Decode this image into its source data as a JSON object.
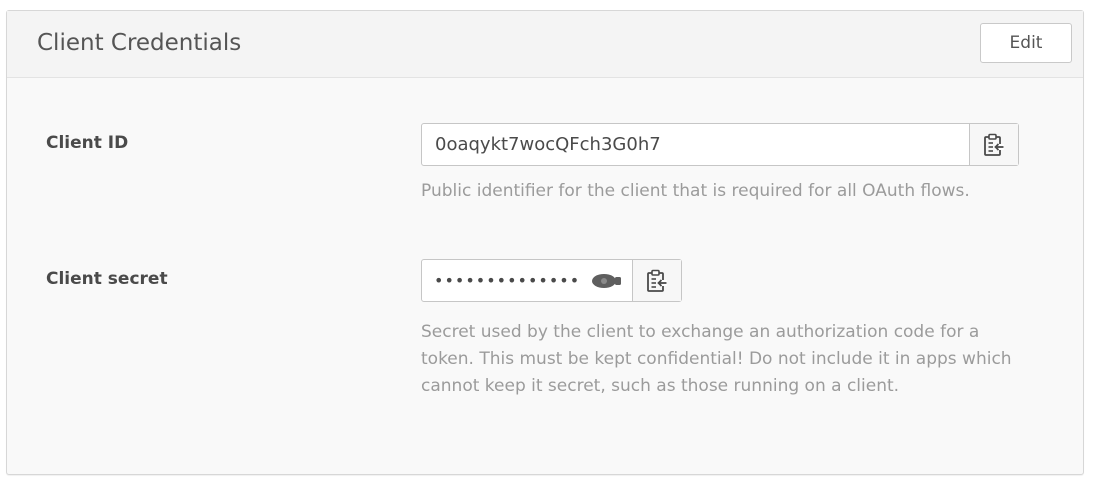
{
  "panel": {
    "title": "Client Credentials",
    "edit_label": "Edit"
  },
  "client_id": {
    "label": "Client ID",
    "value": "0oaqykt7wocQFch3G0h7",
    "help": "Public identifier for the client that is required for all OAuth flows."
  },
  "client_secret": {
    "label": "Client secret",
    "masked_value": "••••••••••••••",
    "help_lines": [
      "Secret used by the client to exchange an authorization code for a",
      "token. This must be kept confidential! Do not include it in apps which",
      "cannot keep it secret, such as those running on a client."
    ]
  },
  "icons": {
    "copy": "clipboard-copy-icon",
    "reveal": "eye-icon"
  },
  "colors": {
    "label": "#4a4a4a",
    "help_text": "#9b9b9b",
    "border": "#c6c6c6",
    "panel_bg": "#f9f9f9"
  }
}
